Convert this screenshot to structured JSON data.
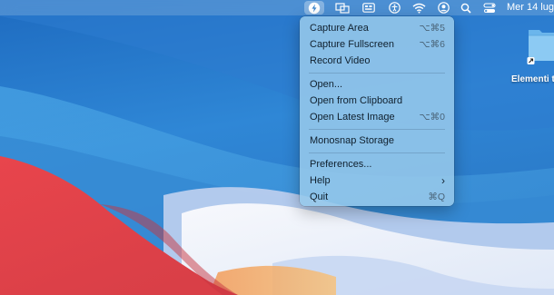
{
  "menubar": {
    "icons": [
      {
        "name": "monosnap-icon",
        "active": true
      },
      {
        "name": "screens-icon"
      },
      {
        "name": "input-menu-icon"
      },
      {
        "name": "accessibility-icon"
      },
      {
        "name": "wifi-icon"
      },
      {
        "name": "user-icon"
      },
      {
        "name": "spotlight-search-icon"
      },
      {
        "name": "control-center-icon"
      }
    ],
    "clock": "Mer 14 lug"
  },
  "menu": {
    "capture_area": {
      "label": "Capture Area",
      "shortcut": "⌥⌘5"
    },
    "capture_fullscreen": {
      "label": "Capture Fullscreen",
      "shortcut": "⌥⌘6"
    },
    "record_video": {
      "label": "Record Video"
    },
    "open": {
      "label": "Open..."
    },
    "open_clipboard": {
      "label": "Open from Clipboard"
    },
    "open_latest": {
      "label": "Open Latest Image",
      "shortcut": "⌥⌘0"
    },
    "storage": {
      "label": "Monosnap Storage"
    },
    "preferences": {
      "label": "Preferences..."
    },
    "help": {
      "label": "Help"
    },
    "quit": {
      "label": "Quit",
      "shortcut": "⌘Q"
    }
  },
  "desktop": {
    "folder_label": "Elementi t"
  },
  "colors": {
    "wallpaper_blue": "#2a7fd0",
    "wallpaper_red": "#e34a4f",
    "wallpaper_white": "#f2f4fa",
    "menu_bg": "#96c8eb"
  }
}
